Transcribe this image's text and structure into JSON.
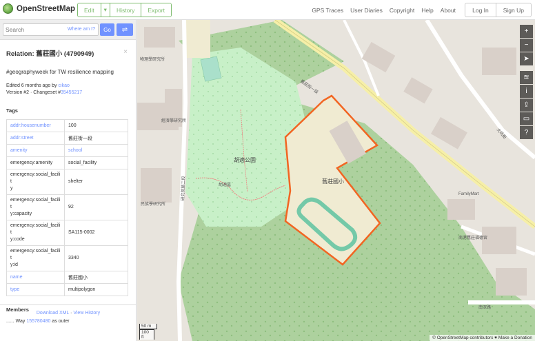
{
  "header": {
    "logo_text": "OpenStreetMap",
    "edit_label": "Edit",
    "edit_dropdown": "▾",
    "history_label": "History",
    "export_label": "Export",
    "nav": [
      "GPS Traces",
      "User Diaries",
      "Copyright",
      "Help",
      "About"
    ],
    "login_label": "Log In",
    "signup_label": "Sign Up"
  },
  "search": {
    "placeholder": "Search",
    "where_am_i": "Where am I?",
    "go_label": "Go",
    "directions_icon": "⇌"
  },
  "relation": {
    "title": "Relation: 舊莊國小 (4790949)",
    "close": "×",
    "comment": "#geographyweek for TW resilience mapping",
    "edited_prefix": "Edited ",
    "edited_time": "6 months ago",
    "edited_by": " by ",
    "user": "cikao",
    "version": "Version #2 · Changeset #",
    "changeset": "35455217"
  },
  "tags_heading": "Tags",
  "tags": [
    {
      "k": "addr:housenumber",
      "v": "100"
    },
    {
      "k": "addr:street",
      "v": "舊莊街一段"
    },
    {
      "k": "amenity",
      "v": "school"
    },
    {
      "k": "emergency:amenity",
      "v": "social_facility"
    },
    {
      "k": "emergency:social_facilit\ny",
      "v": "shelter"
    },
    {
      "k": "emergency:social_facilit\ny:capacity",
      "v": "92"
    },
    {
      "k": "emergency:social_facilit\ny:code",
      "v": "SA115-0002"
    },
    {
      "k": "emergency:social_facilit\ny:id",
      "v": "3340"
    },
    {
      "k": "name",
      "v": "舊莊國小"
    },
    {
      "k": "type",
      "v": "multipolygon"
    }
  ],
  "members_heading": "Members",
  "member": {
    "prefix": "...... Way ",
    "id": "155780480",
    "role": " as outer"
  },
  "footer": {
    "download": "Download XML",
    "sep": " · ",
    "history": "View History"
  },
  "map": {
    "labels": {
      "park": "胡適公園",
      "school": "舊莊國小",
      "institute1": "經濟學研究所",
      "institute2": "民族學研究所",
      "institute3": "物理學研究所",
      "road1": "研究院路二段",
      "road2": "舊莊街一段",
      "road3": "南深路",
      "road4": "大坑街",
      "tomb": "胡適墓",
      "familymart": "FamilyMart",
      "temple": "南港舊莊福德宮"
    },
    "controls": [
      "+",
      "−",
      "➤",
      "≋",
      "i",
      "⇪",
      "▭",
      "?"
    ],
    "scale_top": "50 m",
    "scale_bottom": "100 ft",
    "attribution": "© OpenStreetMap contributors ♥ Make a Donation"
  },
  "colors": {
    "accent": "#7ebc6f",
    "link": "#7092ff",
    "boundary": "#f26522",
    "park": "#c8f0c8",
    "forest": "#add19e",
    "school": "#f0ebd2"
  }
}
